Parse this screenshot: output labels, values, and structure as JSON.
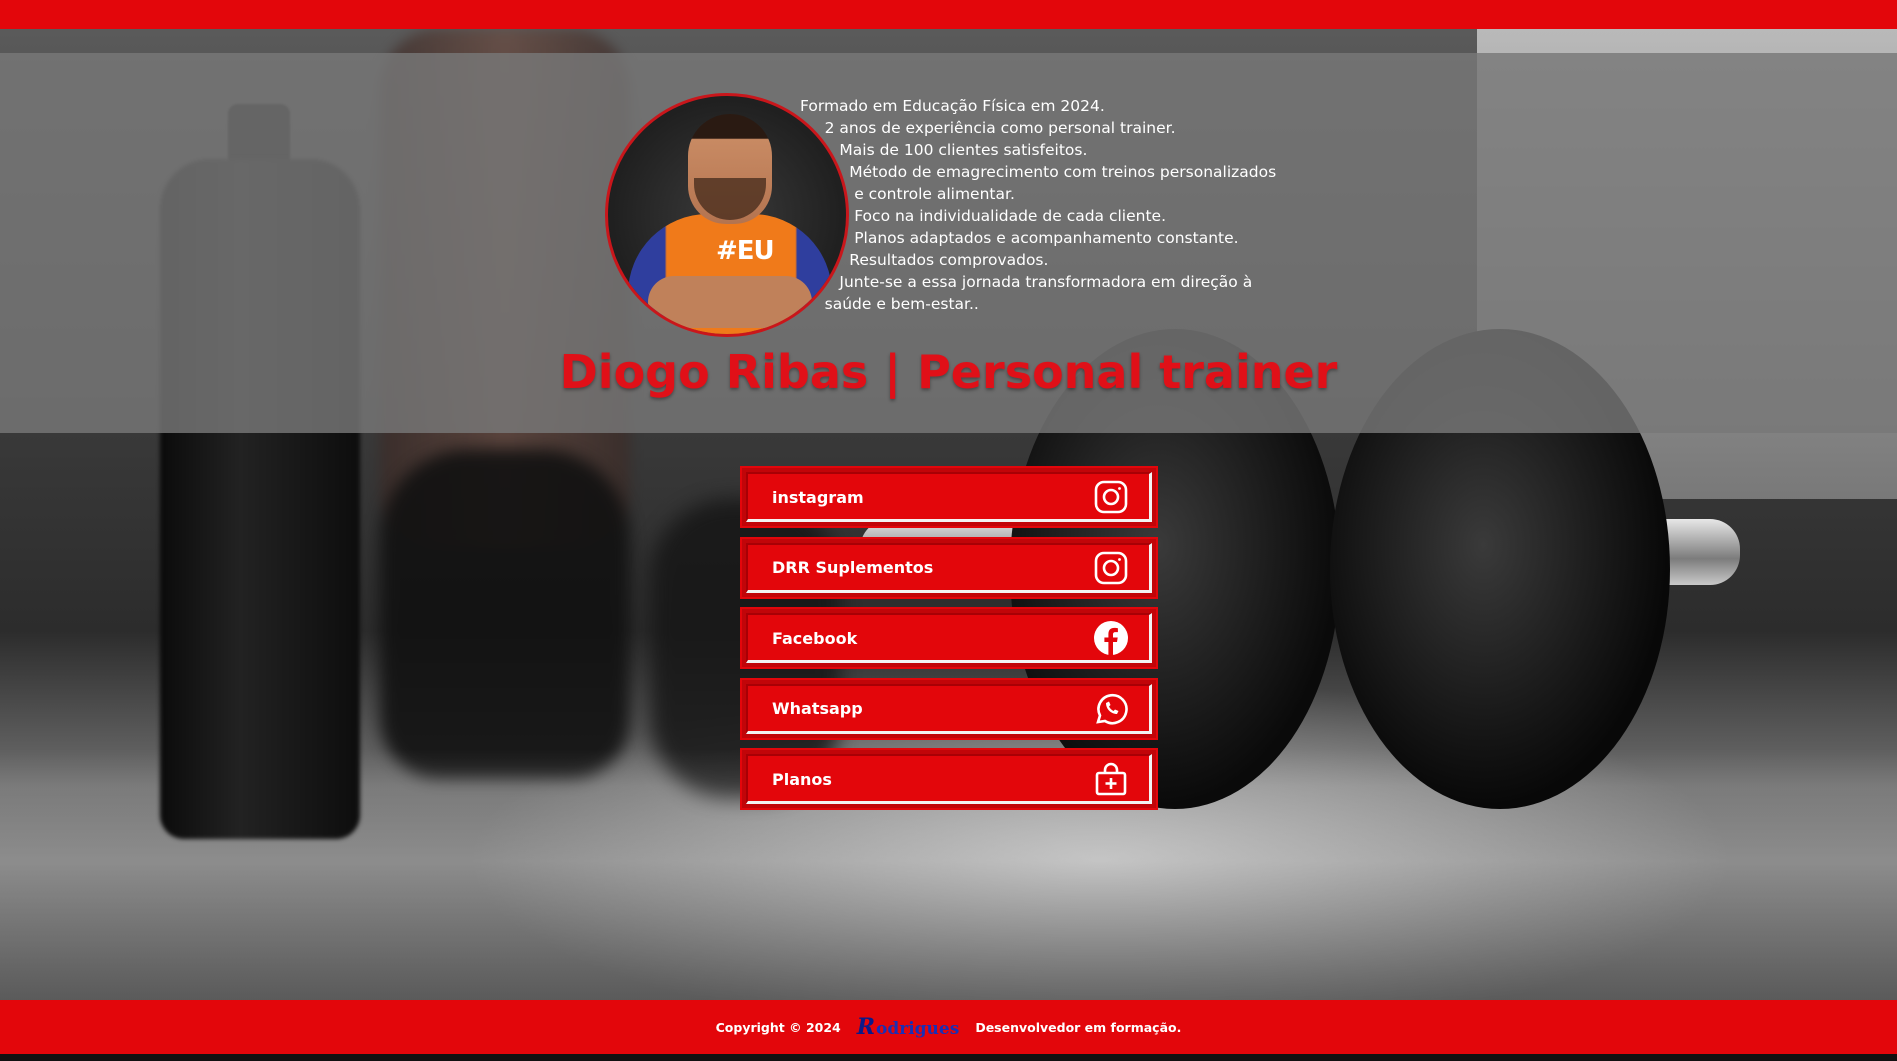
{
  "colors": {
    "accent": "#e3060b",
    "title": "#e01018",
    "panel": "#787878"
  },
  "profile": {
    "avatar_alt": "Diogo Ribas",
    "shirt_logo": "#EU",
    "bio_lines": [
      "Formado em Educação Física em 2024.",
      "     2 anos de experiência como personal trainer.",
      "        Mais de 100 clientes satisfeitos.",
      "          Método de emagrecimento com treinos personalizados",
      "           e controle alimentar.",
      "           Foco na individualidade de cada cliente.",
      "           Planos adaptados e acompanhamento constante.",
      "          Resultados comprovados.",
      "        Junte-se a essa jornada transformadora em direção à",
      "     saúde e bem-estar.."
    ],
    "title": "Diogo Ribas | Personal trainer"
  },
  "links": [
    {
      "label": "instagram",
      "icon": "instagram-icon"
    },
    {
      "label": "DRR Suplementos",
      "icon": "instagram-icon"
    },
    {
      "label": "Facebook",
      "icon": "facebook-icon"
    },
    {
      "label": "Whatsapp",
      "icon": "whatsapp-icon"
    },
    {
      "label": "Planos",
      "icon": "shopping-bag-plus-icon"
    }
  ],
  "footer": {
    "copyright": "Copyright © 2024",
    "brand_initial": "R",
    "brand_rest": "odrigues",
    "tagline": "Desenvolvedor em formação."
  }
}
